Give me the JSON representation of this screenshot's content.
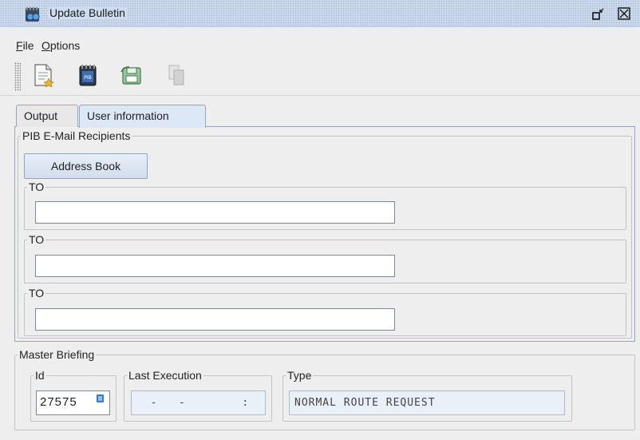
{
  "window": {
    "title": "Update Bulletin"
  },
  "menu": {
    "file": {
      "mnemonic": "F",
      "rest": "ile"
    },
    "options": {
      "mnemonic": "O",
      "rest": "ptions"
    }
  },
  "toolbar": {
    "icons": [
      "new-document-icon",
      "pib-notebook-icon",
      "save-disk-icon",
      "copy-disabled-icon"
    ]
  },
  "tabs": [
    {
      "label": "Output",
      "active": false
    },
    {
      "label": "User information",
      "active": true
    }
  ],
  "recipients": {
    "group_title": "PIB E-Mail Recipients",
    "address_book_label": "Address Book",
    "fields": [
      {
        "label": "TO",
        "value": ""
      },
      {
        "label": "TO",
        "value": ""
      },
      {
        "label": "TO",
        "value": ""
      }
    ]
  },
  "master_briefing": {
    "group_title": "Master Briefing",
    "id": {
      "label": "Id",
      "value": "27575"
    },
    "last_execution": {
      "label": "Last Execution",
      "value": "  -   -        :"
    },
    "type": {
      "label": "Type",
      "value": "NORMAL ROUTE REQUEST"
    }
  },
  "colors": {
    "titlebar": "#cfdcee",
    "tab_active": "#dce7f7",
    "panel_border": "#8fa6c4",
    "readonly_bg": "#eaf0f7"
  }
}
